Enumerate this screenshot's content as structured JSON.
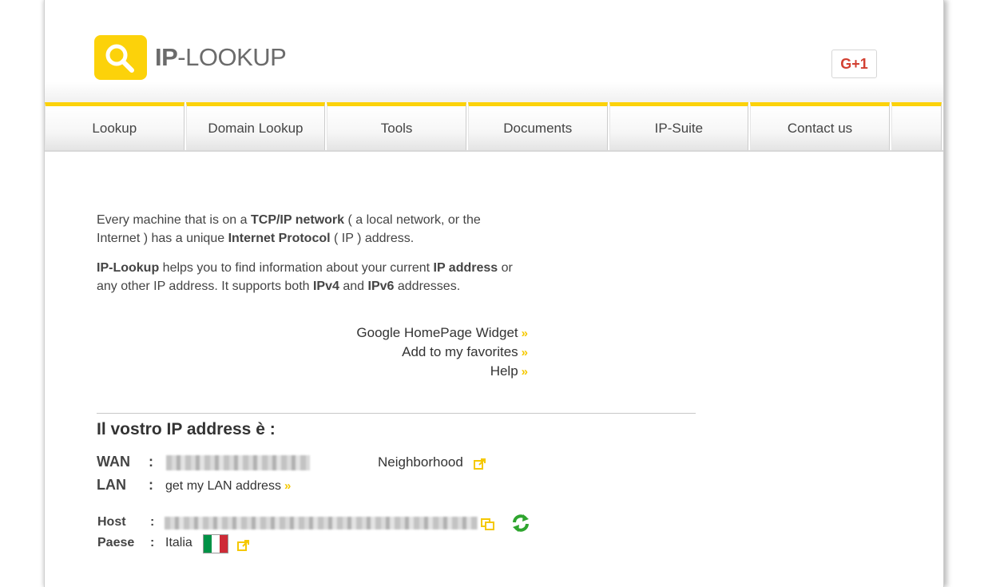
{
  "header": {
    "logo_bold": "IP",
    "logo_rest": "-LOOKUP",
    "gplus_label": "G+1"
  },
  "nav": {
    "items": [
      {
        "label": "Lookup"
      },
      {
        "label": "Domain Lookup"
      },
      {
        "label": "Tools"
      },
      {
        "label": "Documents"
      },
      {
        "label": "IP-Suite"
      },
      {
        "label": "Contact us"
      }
    ]
  },
  "intro": {
    "p1": {
      "a": "Every machine that is on a ",
      "b1": "TCP/IP network",
      "c": " ( a local network, or the Internet ) has a unique ",
      "b2": "Internet Protocol",
      "d": " ( IP ) address."
    },
    "p2": {
      "b1": "IP-Lookup",
      "a": " helps you to find information about your current ",
      "b2": "IP address",
      "c": " or any other IP address. It supports both ",
      "b3": "IPv4",
      "d": " and ",
      "b4": "IPv6",
      "e": " addresses."
    }
  },
  "links": {
    "widget": "Google HomePage Widget",
    "favorites": "Add to my favorites",
    "help": "Help",
    "chevron": "»"
  },
  "ip_section": {
    "title": "Il vostro IP address è :",
    "wan_label": "WAN",
    "lan_label": "LAN",
    "host_label": "Host",
    "paese_label": "Paese",
    "colon": ":",
    "neighborhood": "Neighborhood",
    "lan_link": "get my LAN address",
    "country": "Italia"
  },
  "colors": {
    "accent": "#fcd20a",
    "gplus": "#d23f31",
    "refresh": "#2fa52f",
    "flag_green": "#009246",
    "flag_white": "#ffffff",
    "flag_red": "#ce2b37"
  }
}
